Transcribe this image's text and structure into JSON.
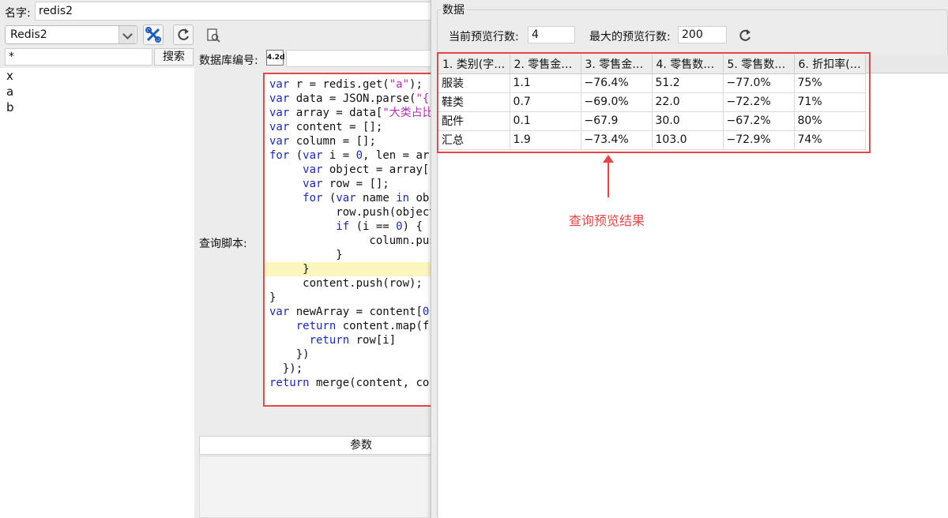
{
  "form": {
    "name_label": "名字:",
    "name_value": "redis2",
    "connection_value": "Redis2",
    "search_value": "*",
    "search_button": "搜索",
    "db_label": "数据库编号:",
    "db_icon_text": "4.2d",
    "script_label": "查询脚本:",
    "params_header": "参数"
  },
  "keys": [
    "x",
    "a",
    "b"
  ],
  "data_panel": {
    "title": "数据",
    "current_rows_label": "当前预览行数:",
    "current_rows_value": "4",
    "max_rows_label": "最大的预览行数:",
    "max_rows_value": "200",
    "columns": [
      "1. 类别(字…",
      "2. 零售金…",
      "3. 零售金…",
      "4. 零售数…",
      "5. 零售数…",
      "6. 折扣率(…"
    ],
    "rows": [
      [
        "服装",
        "1.1",
        "−76.4%",
        "51.2",
        "−77.0%",
        "75%"
      ],
      [
        "鞋类",
        "0.7",
        "−69.0%",
        "22.0",
        "−72.2%",
        "71%"
      ],
      [
        "配件",
        "0.1",
        "−67.9",
        "30.0",
        "−67.2%",
        "80%"
      ],
      [
        "汇总",
        "1.9",
        "−73.4%",
        "103.0",
        "−72.9%",
        "74%"
      ]
    ],
    "annotation": "查询预览结果"
  },
  "colors": {
    "annotation_red": "#e24646",
    "keyword_blue": "#1a28b5",
    "string_purple": "#b12db0"
  }
}
